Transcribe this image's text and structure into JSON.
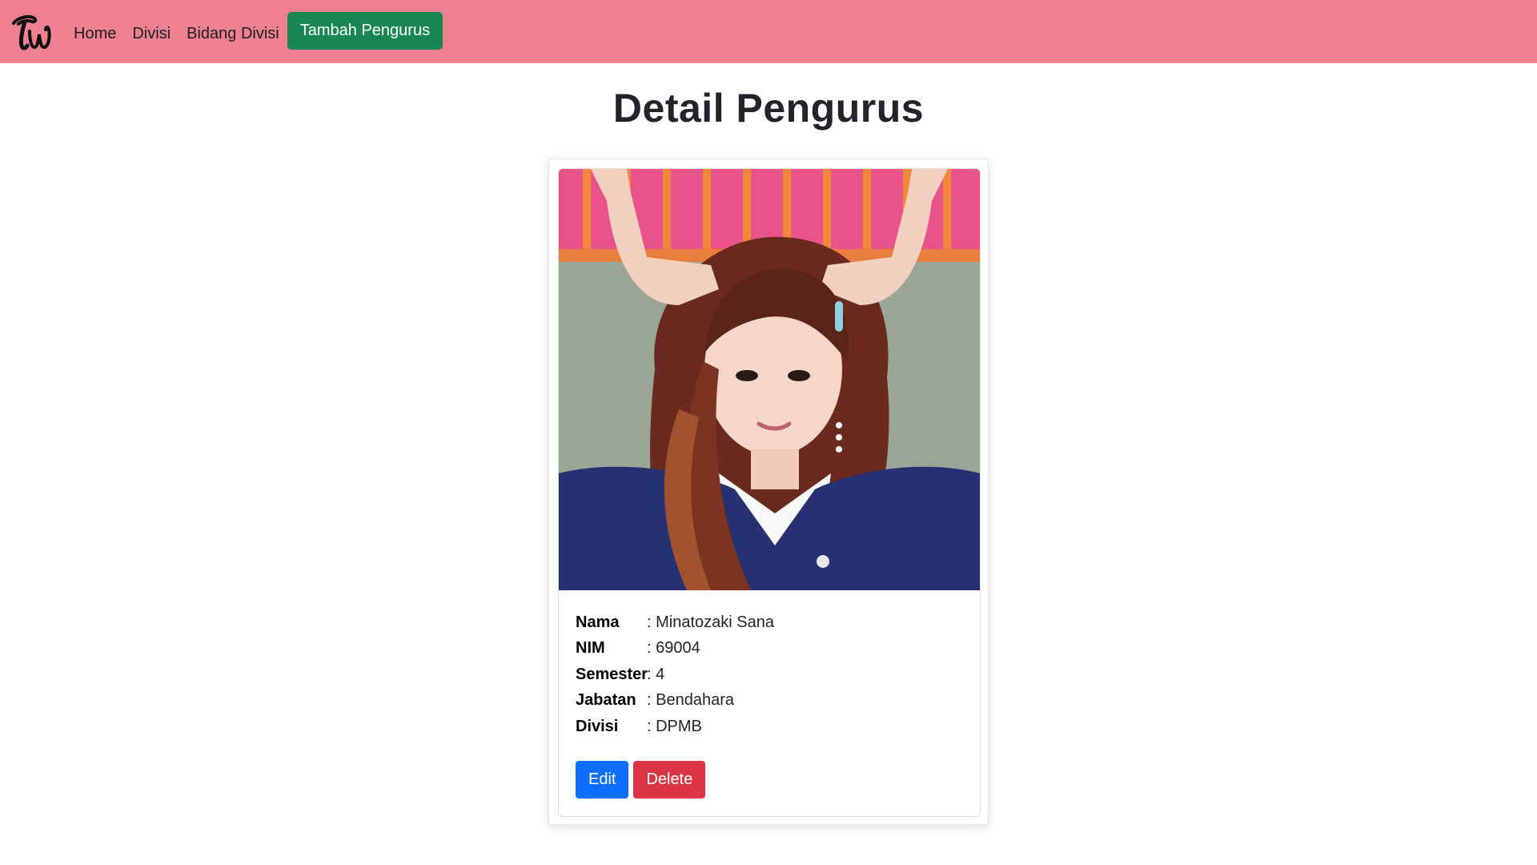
{
  "navbar": {
    "brand_icon": "twice-logo-icon",
    "links": [
      {
        "label": "Home"
      },
      {
        "label": "Divisi"
      },
      {
        "label": "Bidang Divisi"
      }
    ],
    "cta_label": "Tambah Pengurus",
    "colors": {
      "background": "#ef808f",
      "cta": "#198754"
    }
  },
  "page": {
    "title": "Detail Pengurus"
  },
  "member": {
    "photo_icon": "member-photo",
    "fields": [
      {
        "label": "Nama",
        "value": ": Minatozaki Sana"
      },
      {
        "label": "NIM",
        "value": ": 69004"
      },
      {
        "label": "Semester",
        "value": ": 4"
      },
      {
        "label": "Jabatan",
        "value": ": Bendahara"
      },
      {
        "label": "Divisi",
        "value": ": DPMB"
      }
    ]
  },
  "actions": {
    "edit_label": "Edit",
    "delete_label": "Delete",
    "colors": {
      "edit": "#0d6efd",
      "delete": "#dc3545"
    }
  }
}
